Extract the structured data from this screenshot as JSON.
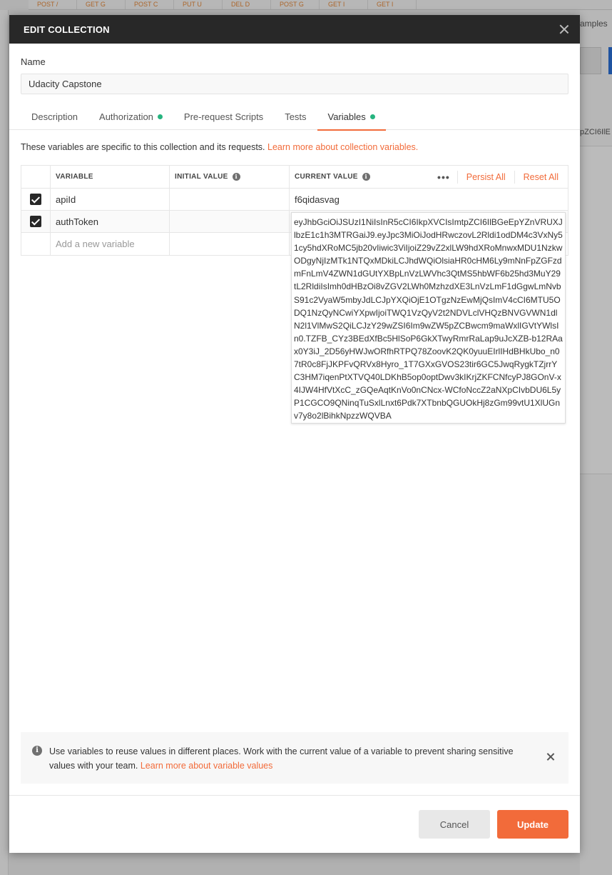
{
  "background": {
    "tabs": [
      "POST /",
      "GET G",
      "POST C",
      "PUT U",
      "DEL D",
      "POST G",
      "GET I",
      "GET I"
    ],
    "right_label": "amples",
    "right_token": "pZCI6IlE"
  },
  "modal": {
    "title": "EDIT COLLECTION",
    "name_label": "Name",
    "name_value": "Udacity Capstone",
    "tabs": [
      {
        "label": "Description",
        "dot": false,
        "active": false
      },
      {
        "label": "Authorization",
        "dot": true,
        "active": false
      },
      {
        "label": "Pre-request Scripts",
        "dot": false,
        "active": false
      },
      {
        "label": "Tests",
        "dot": false,
        "active": false
      },
      {
        "label": "Variables",
        "dot": true,
        "active": true
      }
    ],
    "description_text": "These variables are specific to this collection and its requests.",
    "description_link": "Learn more about collection variables.",
    "table": {
      "headers": {
        "variable": "VARIABLE",
        "initial_value": "INITIAL VALUE",
        "current_value": "CURRENT VALUE",
        "more": "•••",
        "persist_all": "Persist All",
        "reset_all": "Reset All"
      },
      "rows": [
        {
          "checked": true,
          "variable": "apiId",
          "initial": "",
          "current": "f6qidasvag"
        },
        {
          "checked": true,
          "variable": "authToken",
          "initial": "",
          "current": "eyJhbGciOiJSUzI1NiIsInR5cCI6IkpXVCIsImtpZCI6IlBGeEpYZnVRUXJlbzE1c1h3MTRGaiJ9.eyJpc3MiOiJodHRwczovL2Rldi1odDM4c3VxNy51cy5hdXRoMC5jb20vIiwic3ViIjoiZ29vZ2xlLW9hdXRoMnwxMDU1NzkwODgyNjIzMTk1NTQxMDkiLCJhdWQiOlsiaHR0cHM6Ly9mNnFpZGFzdmFnLmV4ZWN1dGUtYXBpLnVzLWVhc3QtMS5hbWF6b25hd3MuY29tL2RldiIsImh0dHBzOi8vZGV2LWh0MzhzdXE3LnVzLmF1dGgwLmNvbS91c2VyaW5mbyJdLCJpYXQiOjE1OTgzNzEwMjQsImV4cCI6MTU5ODQ1NzQyNCwiYXpwIjoiTWQ1VzQyV2t2NDVLclVHQzBNVGVWN1dlN2l1VlMwS2QiLCJzY29wZSI6Im9wZW5pZCBwcm9maWxlIGVtYWlsIn0.TZFB_CYz3BEdXfBc5HlSoP6GkXTwyRmrRaLap9uJcXZB-b12RAax0Y3iJ_2D56yHWJwORfhRTPQ78ZoovK2QK0yuuEIrlIHdBHkUbo_n07tR0c8FjJKPFvQRVx8Hyro_1T7GXxGVOS23tir6GC5JwqRygkTZjrrYC3HM7iqenPtXTVQ40LDKhB5op0optDwv3kIKrjZKFCNfcyPJ8GOnV-x4IJW4HfVtXcC_zGQeAqtKnVo0nCNcx-WCfoNccZ2aNXpCIvbDU6L5yP1CGCO9QNinqTuSxlLnxt6Pdk7XTbnbQGUOkHj8zGm99vtU1XlUGnv7y8o2lBihkNpzzWQVBA"
        }
      ],
      "add_placeholder": "Add a new variable"
    },
    "banner": {
      "icon": "info-icon",
      "text": "Use variables to reuse values in different places. Work with the current value of a variable to prevent sharing sensitive values with your team.",
      "link": "Learn more about variable values"
    },
    "buttons": {
      "cancel": "Cancel",
      "update": "Update"
    }
  },
  "colors": {
    "accent": "#f26b3a",
    "header_bg": "#282828",
    "status_dot": "#26b47f"
  }
}
